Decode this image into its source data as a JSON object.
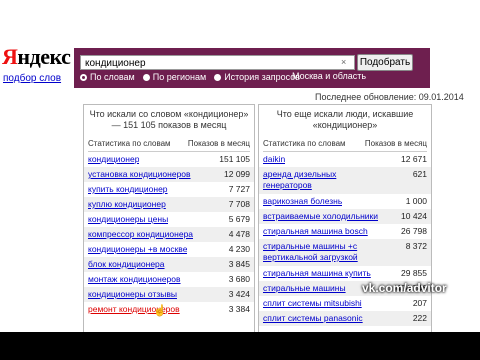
{
  "logo": {
    "first": "Я",
    "rest": "ндекс",
    "sub": "подбор слов"
  },
  "search": {
    "value": "кондиционер",
    "clear_icon": "×",
    "button": "Подобрать"
  },
  "radios": [
    {
      "label": "По словам",
      "selected": true
    },
    {
      "label": "По регионам",
      "selected": false
    },
    {
      "label": "История запросов",
      "selected": false
    }
  ],
  "region": "Москва и область",
  "updated": "Последнее обновление: 09.01.2014",
  "left": {
    "title": "Что искали со словом «кондиционер» — 151 105 показов в месяц",
    "col1": "Статистика по словам",
    "col2": "Показов в месяц",
    "rows": [
      {
        "w": "кондиционер",
        "n": "151 105"
      },
      {
        "w": "установка кондиционеров",
        "n": "12 099"
      },
      {
        "w": "купить кондиционер",
        "n": "7 727"
      },
      {
        "w": "куплю кондиционер",
        "n": "7 708"
      },
      {
        "w": "кондиционеры цены",
        "n": "5 679"
      },
      {
        "w": "компрессор кондиционера",
        "n": "4 478"
      },
      {
        "w": "кондиционеры +в москве",
        "n": "4 230"
      },
      {
        "w": "блок кондиционера",
        "n": "3 845"
      },
      {
        "w": "монтаж кондиционеров",
        "n": "3 680"
      },
      {
        "w": "кондиционеры отзывы",
        "n": "3 424"
      },
      {
        "w": "ремонт кондиционеров",
        "n": "3 384"
      }
    ]
  },
  "right": {
    "title": "Что еще искали люди, искавшие «кондиционер»",
    "col1": "Статистика по словам",
    "col2": "Показов в месяц",
    "rows": [
      {
        "w": "daikin",
        "n": "12 671"
      },
      {
        "w": "аренда дизельных генераторов",
        "n": "621"
      },
      {
        "w": "варикозная болезнь",
        "n": "1 000"
      },
      {
        "w": "встраиваемые холодильники",
        "n": "10 424"
      },
      {
        "w": "стиральная машина bosch",
        "n": "26 798"
      },
      {
        "w": "стиральные машины +с вертикальной загрузкой",
        "n": "8 372"
      },
      {
        "w": "стиральная машина купить",
        "n": "29 855"
      },
      {
        "w": "стиральные машины",
        "n": "404 746"
      },
      {
        "w": "сплит системы mitsubishi",
        "n": "207"
      },
      {
        "w": "сплит системы panasonic",
        "n": "222"
      }
    ]
  },
  "watermark": "vk.com/advitor"
}
